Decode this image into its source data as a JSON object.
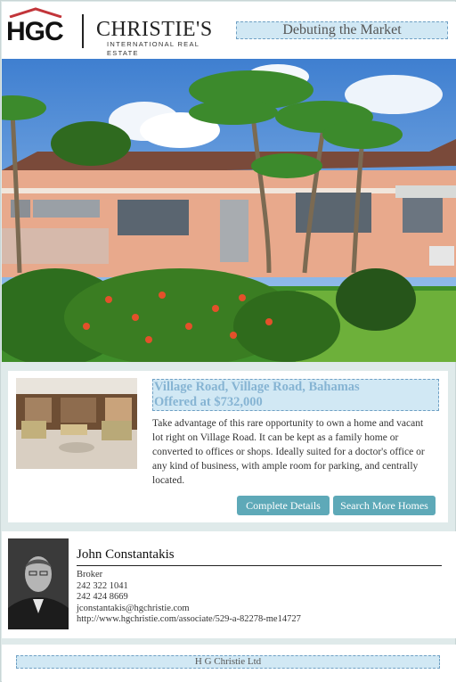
{
  "header": {
    "logo_text": "HGC",
    "partner_logo_main": "CHRISTIE'S",
    "partner_logo_sub": "INTERNATIONAL REAL ESTATE",
    "tagline": "Debuting the Market"
  },
  "listing": {
    "title_line1": "Village Road, Village Road, Bahamas",
    "title_line2": "Offered at $732,000",
    "description": "Take advantage of this rare opportunity to own a home and vacant lot right on Village Road. It can be kept as a family home or converted to offices or shops. Ideally suited for a doctor's office or any kind of business, with ample room for parking, and centrally located.",
    "buttons": {
      "details": "Complete Details",
      "search": "Search More Homes"
    }
  },
  "agent": {
    "name": "John Constantakis",
    "title": "Broker",
    "phone1": "242 322 1041",
    "phone2": "242 424 8669",
    "email": "jconstantakis@hgchristie.com",
    "url": "http://www.hgchristie.com/associate/529-a-82278-me14727"
  },
  "footer": {
    "company": "H G Christie Ltd"
  },
  "colors": {
    "button": "#5ea9b8",
    "title": "#86b4d3",
    "background": "#dfeaea",
    "editable_fill": "#bedef0"
  },
  "icons": [
    "house-roof-icon",
    "pencil-edit-icon"
  ]
}
